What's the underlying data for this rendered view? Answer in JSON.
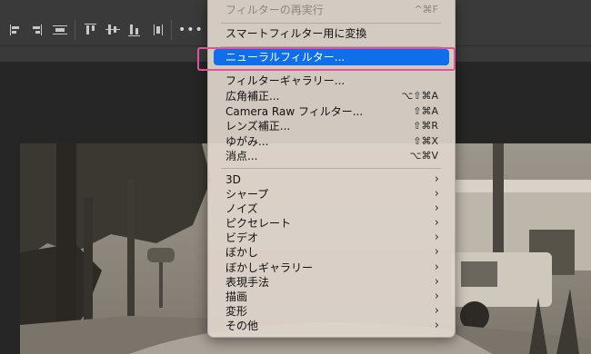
{
  "toolbar": {
    "more_label": "•••",
    "icons": [
      "align-left-edges-icon",
      "align-right-edges-icon",
      "align-horizontal-centers-icon",
      "align-top-edges-icon",
      "align-vertical-centers-icon",
      "align-bottom-edges-icon",
      "distribute-icon",
      "more-options-icon"
    ]
  },
  "menu": {
    "reapply": {
      "label": "フィルターの再実行",
      "shortcut": "^⌘F"
    },
    "convert_smart": {
      "label": "スマートフィルター用に変換"
    },
    "neural": {
      "label": "ニューラルフィルター..."
    },
    "gallery": {
      "label": "フィルターギャラリー..."
    },
    "wide_angle": {
      "label": "広角補正...",
      "shortcut": "⌥⇧⌘A"
    },
    "camera_raw": {
      "label": "Camera Raw フィルター...",
      "shortcut": "⇧⌘A"
    },
    "lens": {
      "label": "レンズ補正...",
      "shortcut": "⇧⌘R"
    },
    "liquify": {
      "label": "ゆがみ...",
      "shortcut": "⇧⌘X"
    },
    "vanishing": {
      "label": "消点...",
      "shortcut": "⌥⌘V"
    },
    "submenus": [
      {
        "label": "3D",
        "arrow": "›"
      },
      {
        "label": "シャープ",
        "arrow": "›"
      },
      {
        "label": "ノイズ",
        "arrow": "›"
      },
      {
        "label": "ピクセレート",
        "arrow": "›"
      },
      {
        "label": "ビデオ",
        "arrow": "›"
      },
      {
        "label": "ぼかし",
        "arrow": "›"
      },
      {
        "label": "ぼかしギャラリー",
        "arrow": "›"
      },
      {
        "label": "表現手法",
        "arrow": "›"
      },
      {
        "label": "描画",
        "arrow": "›"
      },
      {
        "label": "変形",
        "arrow": "›"
      },
      {
        "label": "その他",
        "arrow": "›"
      }
    ]
  },
  "colors": {
    "highlight": "#0f6ee8",
    "callout": "#e0529c",
    "toolbar_bg": "#3a3a3a",
    "workspace_bg": "#262626"
  }
}
